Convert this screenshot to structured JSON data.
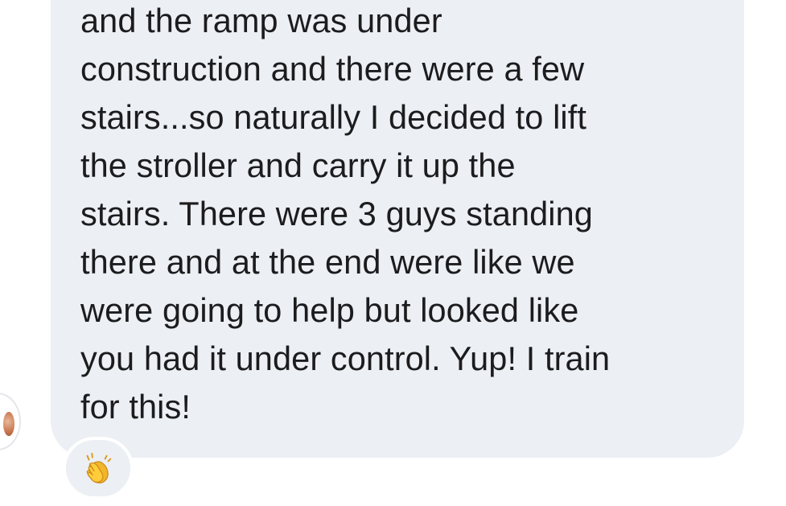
{
  "message": {
    "lines": [
      "and the ramp was under",
      "construction and there were a few",
      "stairs...so naturally I decided to lift",
      "the stroller and carry it up the",
      "stairs. There were 3 guys standing",
      "there and at the end were like we",
      "were going to help but looked like",
      "you had it under control. Yup! I train",
      "for this!"
    ]
  },
  "reaction": {
    "icon": "clapping-hands-icon"
  },
  "colors": {
    "bubble_background": "#eceff3",
    "text": "#1c1c1e",
    "page_background": "#ffffff"
  }
}
